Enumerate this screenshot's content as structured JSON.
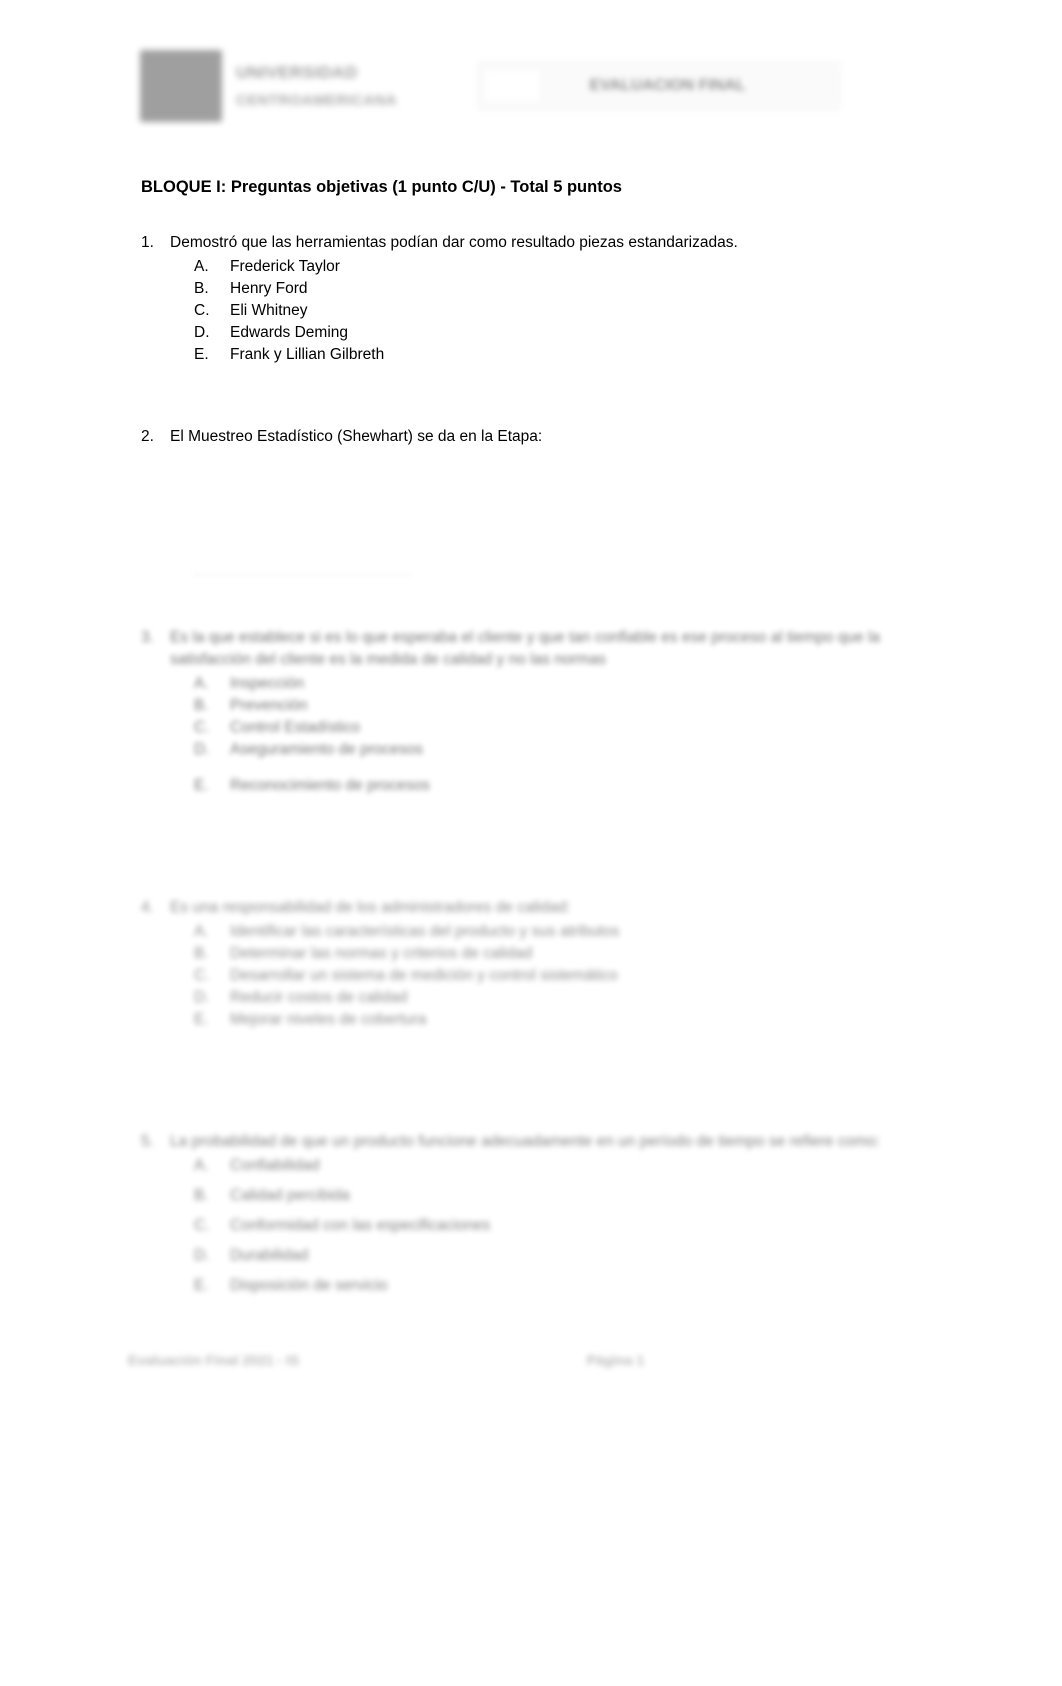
{
  "header": {
    "logo_mark": "university-seal",
    "logo_line1": "UNIVERSIDAD",
    "logo_line2": "CENTROAMERICANA",
    "title_box_label": "EVALUACION FINAL"
  },
  "document": {
    "block_title": "BLOQUE I: Preguntas objetivas (1 punto C/U) -  Total 5 puntos",
    "questions": [
      {
        "number": "1.",
        "text": "Demostró que las herramientas podían dar como resultado piezas estandarizadas.",
        "blur": "none",
        "options": [
          {
            "letter": "A.",
            "text": "Frederick Taylor"
          },
          {
            "letter": "B.",
            "text": "Henry Ford"
          },
          {
            "letter": "C.",
            "text": "Eli Whitney"
          },
          {
            "letter": "D.",
            "text": "Edwards Deming"
          },
          {
            "letter": "E.",
            "text": "Frank y Lillian Gilbreth"
          }
        ]
      },
      {
        "number": "2.",
        "text": "El Muestreo Estadístico (Shewhart) se da en la Etapa:",
        "blur": "none",
        "options": []
      },
      {
        "number": "3.",
        "text": "Es la que establece si es lo que esperaba el cliente y que tan confiable es ese proceso al tiempo que la satisfacción del cliente es la medida de calidad y no las normas",
        "blur": "heavy",
        "options": [
          {
            "letter": "A.",
            "text": "Inspección"
          },
          {
            "letter": "B.",
            "text": "Prevención"
          },
          {
            "letter": "C.",
            "text": "Control Estadístico"
          },
          {
            "letter": "D.",
            "text": "Aseguramiento de procesos"
          },
          {
            "letter": "E.",
            "text": "Reconocimiento de procesos"
          }
        ]
      },
      {
        "number": "4.",
        "text": "Es una responsabilidad de los administradores de calidad:",
        "blur": "heavy",
        "options": [
          {
            "letter": "A.",
            "text": "Identificar las características del producto y sus atributos"
          },
          {
            "letter": "B.",
            "text": "Determinar las normas y criterios de calidad"
          },
          {
            "letter": "C.",
            "text": "Desarrollar un sistema de medición y control sistemático"
          },
          {
            "letter": "D.",
            "text": "Reducir costos de calidad"
          },
          {
            "letter": "E.",
            "text": "Mejorar niveles de cobertura"
          }
        ]
      },
      {
        "number": "5.",
        "text": "La probabilidad de que un producto funcione adecuadamente en un período de tiempo se refiere como:",
        "blur": "heavy",
        "options": [
          {
            "letter": "A.",
            "text": "Confiabilidad"
          },
          {
            "letter": "B.",
            "text": "Calidad percibida"
          },
          {
            "letter": "C.",
            "text": "Conformidad con las especificaciones"
          },
          {
            "letter": "D.",
            "text": "Durabilidad"
          },
          {
            "letter": "E.",
            "text": "Disposición de servicio"
          }
        ]
      }
    ]
  },
  "footer": {
    "left": "Evaluación Final 2021 - IS",
    "center": "Página",
    "page_number": "1",
    "right": ""
  }
}
